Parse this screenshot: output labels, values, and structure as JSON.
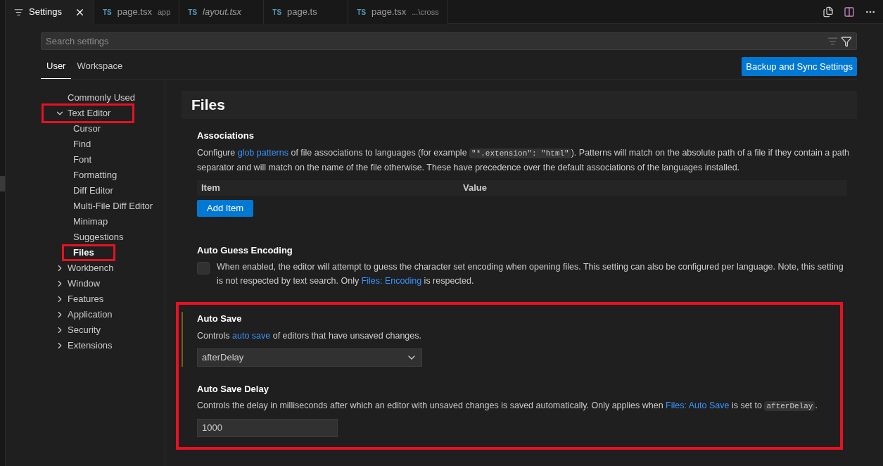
{
  "tabs": [
    {
      "kind": "settings",
      "label": "Settings",
      "selected": true
    },
    {
      "kind": "ts",
      "badge": "TS",
      "label": "page.tsx",
      "hint": "app",
      "italic": false,
      "selected": false
    },
    {
      "kind": "ts",
      "badge": "TS",
      "label": "layout.tsx",
      "italic": true,
      "selected": false
    },
    {
      "kind": "ts",
      "badge": "TS",
      "label": "page.ts",
      "italic": false,
      "selected": false
    },
    {
      "kind": "ts",
      "badge": "TS",
      "label": "page.tsx",
      "hint": "...\\cross",
      "italic": false,
      "selected": false
    }
  ],
  "search": {
    "placeholder": "Search settings"
  },
  "scopes": [
    {
      "label": "User",
      "selected": true
    },
    {
      "label": "Workspace",
      "selected": false
    }
  ],
  "sync_button": "Backup and Sync Settings",
  "toc": [
    {
      "label": "Commonly Used",
      "selected": false,
      "highlighted": false
    },
    {
      "label": "Text Editor",
      "expanded": true,
      "selected": false,
      "highlighted": true,
      "children": [
        {
          "label": "Cursor",
          "selected": false,
          "highlighted": false
        },
        {
          "label": "Find",
          "selected": false,
          "highlighted": false
        },
        {
          "label": "Font",
          "selected": false,
          "highlighted": false
        },
        {
          "label": "Formatting",
          "selected": false,
          "highlighted": false
        },
        {
          "label": "Diff Editor",
          "selected": false,
          "highlighted": false
        },
        {
          "label": "Multi-File Diff Editor",
          "selected": false,
          "highlighted": false
        },
        {
          "label": "Minimap",
          "selected": false,
          "highlighted": false
        },
        {
          "label": "Suggestions",
          "selected": false,
          "highlighted": false
        },
        {
          "label": "Files",
          "selected": true,
          "highlighted": true
        }
      ]
    },
    {
      "label": "Workbench",
      "expanded": false,
      "selected": false,
      "highlighted": false
    },
    {
      "label": "Window",
      "expanded": false,
      "selected": false,
      "highlighted": false
    },
    {
      "label": "Features",
      "expanded": false,
      "selected": false,
      "highlighted": false
    },
    {
      "label": "Application",
      "expanded": false,
      "selected": false,
      "highlighted": false
    },
    {
      "label": "Security",
      "expanded": false,
      "selected": false,
      "highlighted": false
    },
    {
      "label": "Extensions",
      "expanded": false,
      "selected": false,
      "highlighted": false
    }
  ],
  "content": {
    "heading": "Files",
    "groups": [
      {
        "highlighted": false,
        "settings": [
          {
            "kind": "list",
            "title": "Associations",
            "focused": false,
            "description": [
              {
                "kind": "text",
                "text": "Configure "
              },
              {
                "kind": "link",
                "text": "glob patterns"
              },
              {
                "kind": "text",
                "text": " of file associations to languages (for example "
              },
              {
                "kind": "code",
                "text": "\"*.extension\": \"html\""
              },
              {
                "kind": "text",
                "text": "). Patterns will match on the absolute path of a file if they contain a path separator and will match on the name of the file otherwise. These have precedence over the default associations of the languages installed."
              }
            ],
            "columns": [
              "Item",
              "Value"
            ],
            "button": "Add Item"
          },
          {
            "kind": "checkbox",
            "title": "Auto Guess Encoding",
            "focused": false,
            "checked": false,
            "description": [
              {
                "kind": "text",
                "text": "When enabled, the editor will attempt to guess the character set encoding when opening files. This setting can also be configured per language. Note, this setting is not respected by text search. Only "
              },
              {
                "kind": "link",
                "text": "Files: Encoding"
              },
              {
                "kind": "text",
                "text": " is respected."
              }
            ]
          }
        ]
      },
      {
        "highlighted": true,
        "settings": [
          {
            "kind": "dropdown",
            "title": "Auto Save",
            "focused": true,
            "description": [
              {
                "kind": "text",
                "text": "Controls "
              },
              {
                "kind": "link",
                "text": "auto save"
              },
              {
                "kind": "text",
                "text": " of editors that have unsaved changes."
              }
            ],
            "value": "afterDelay"
          },
          {
            "kind": "number",
            "title": "Auto Save Delay",
            "focused": false,
            "description": [
              {
                "kind": "text",
                "text": "Controls the delay in milliseconds after which an editor with unsaved changes is saved automatically. Only applies when "
              },
              {
                "kind": "link",
                "text": "Files: Auto Save"
              },
              {
                "kind": "text",
                "text": " is set to "
              },
              {
                "kind": "code",
                "text": "afterDelay"
              },
              {
                "kind": "text",
                "text": "."
              }
            ],
            "value": "1000"
          }
        ]
      }
    ]
  }
}
